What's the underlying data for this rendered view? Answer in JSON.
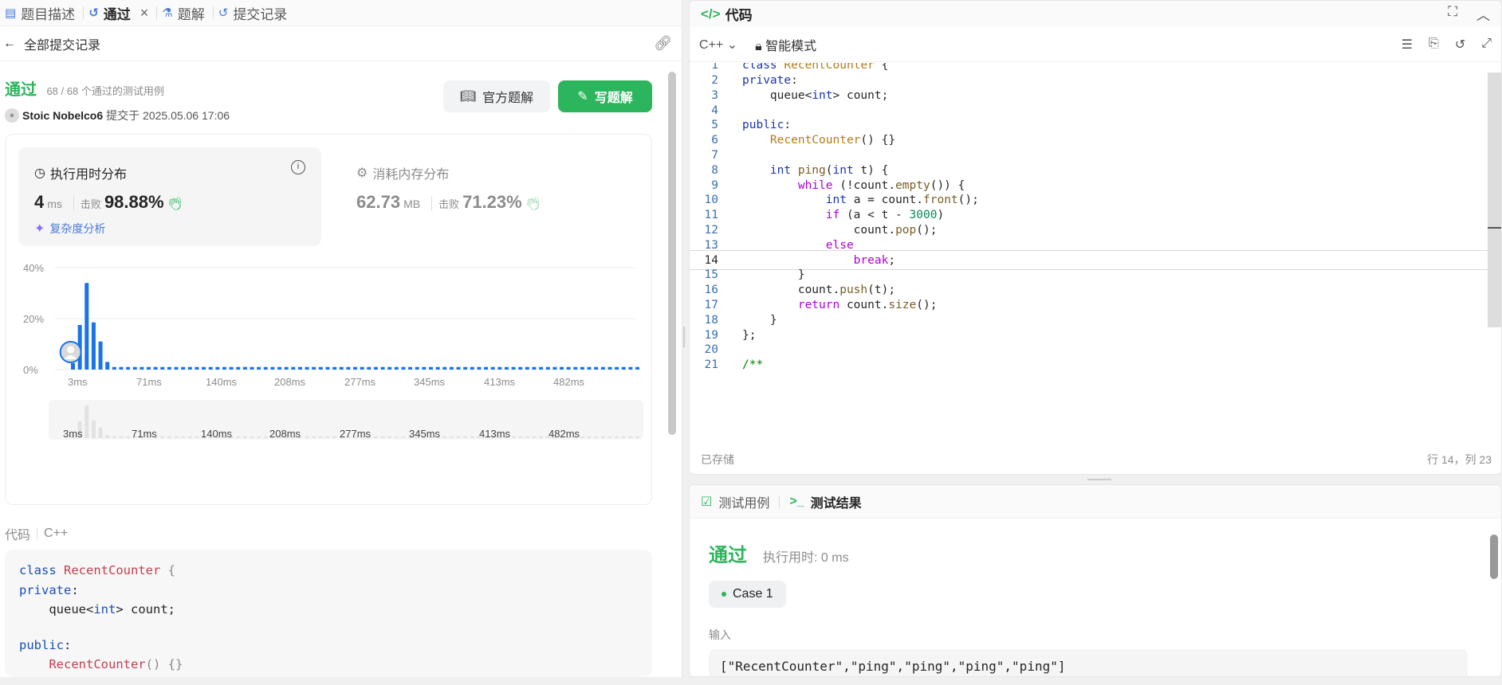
{
  "tabs": [
    {
      "label": "题目描述",
      "icon": "document-icon"
    },
    {
      "label": "通过",
      "icon": "history-icon",
      "active": true
    },
    {
      "label": "题解",
      "icon": "flask-icon"
    },
    {
      "label": "提交记录",
      "icon": "history-icon"
    }
  ],
  "back": {
    "label": "全部提交记录"
  },
  "result": {
    "status": "通过",
    "summary": "68 / 68 个通过的测试用例",
    "user": "Stoic Nobelco6",
    "submitted_at": "提交于 2025.05.06 17:06"
  },
  "buttons": {
    "official": "官方题解",
    "write": "写题解"
  },
  "runtime": {
    "title": "执行用时分布",
    "value": "4",
    "unit": "ms",
    "beat_label": "击败",
    "beat": "98.88%",
    "complexity": "复杂度分析"
  },
  "memory": {
    "title": "消耗内存分布",
    "value": "62.73",
    "unit": "MB",
    "beat_label": "击败",
    "beat": "71.23%"
  },
  "chart_data": {
    "type": "bar",
    "title": "",
    "xlabel": "",
    "ylabel": "",
    "y_ticks": [
      "40%",
      "20%",
      "0%"
    ],
    "ylim": [
      0,
      40
    ],
    "x_ticks": [
      "3ms",
      "71ms",
      "140ms",
      "208ms",
      "277ms",
      "345ms",
      "413ms",
      "482ms"
    ],
    "values": [
      2.5,
      17.5,
      34,
      18.5,
      11,
      3,
      1,
      1,
      1,
      1,
      1,
      1,
      1,
      1,
      1,
      1,
      1,
      1,
      1,
      1,
      1,
      1,
      1,
      1,
      1,
      1,
      1,
      1,
      1,
      1,
      1,
      1,
      1,
      1,
      1,
      1,
      1,
      1,
      1,
      1,
      1,
      1,
      1,
      1,
      1,
      1,
      1,
      1,
      1,
      1,
      1,
      1,
      1,
      1,
      1,
      1,
      1,
      1,
      1,
      1,
      1,
      1,
      1,
      1,
      1,
      1,
      1,
      1,
      1,
      1,
      1,
      1,
      1,
      1,
      1,
      1,
      1,
      1,
      1,
      1,
      1,
      1,
      1
    ],
    "highlight_index": 1,
    "color": "#1a73e8",
    "grid": true
  },
  "code_section": {
    "label": "代码",
    "lang": "C++"
  },
  "code_preview": [
    [
      [
        "kw",
        "class "
      ],
      [
        "cls",
        "RecentCounter"
      ],
      [
        "gr",
        " {"
      ]
    ],
    [
      [
        "kw",
        "private"
      ],
      [
        "pl",
        ":"
      ]
    ],
    [
      [
        "pl",
        "    queue<"
      ],
      [
        "kw",
        "int"
      ],
      [
        "pl",
        "> count;"
      ]
    ],
    [
      [
        "pl",
        ""
      ]
    ],
    [
      [
        "kw",
        "public"
      ],
      [
        "pl",
        ":"
      ]
    ],
    [
      [
        "cls",
        "    RecentCounter"
      ],
      [
        "gr",
        "() {}"
      ]
    ]
  ],
  "editor": {
    "title": "代码",
    "lang": "C++",
    "mode": "智能模式",
    "saved": "已存储",
    "cursor": "行 14，列 23",
    "current_line": 14,
    "lines": [
      [
        [
          "kw",
          "class "
        ],
        [
          "cls",
          "RecentCounter "
        ],
        [
          "pl",
          "{"
        ]
      ],
      [
        [
          "kw",
          "private"
        ],
        [
          "pl",
          ":"
        ]
      ],
      [
        [
          "pl",
          "    queue<"
        ],
        [
          "kw",
          "int"
        ],
        [
          "pl",
          "> count;"
        ]
      ],
      [
        [
          "pl",
          ""
        ]
      ],
      [
        [
          "kw",
          "public"
        ],
        [
          "pl",
          ":"
        ]
      ],
      [
        [
          "cls",
          "    RecentCounter"
        ],
        [
          "pl",
          "() {}"
        ]
      ],
      [
        [
          "pl",
          ""
        ]
      ],
      [
        [
          "kw",
          "    int "
        ],
        [
          "fn",
          "ping"
        ],
        [
          "pl",
          "("
        ],
        [
          "kw",
          "int "
        ],
        [
          "pl",
          "t) {"
        ]
      ],
      [
        [
          "ctl",
          "        while "
        ],
        [
          "pl",
          "(!count."
        ],
        [
          "fn",
          "empty"
        ],
        [
          "pl",
          "()) {"
        ]
      ],
      [
        [
          "kw",
          "            int "
        ],
        [
          "pl",
          "a = count."
        ],
        [
          "fn",
          "front"
        ],
        [
          "pl",
          "();"
        ]
      ],
      [
        [
          "ctl",
          "            if "
        ],
        [
          "pl",
          "(a < t - "
        ],
        [
          "num",
          "3000"
        ],
        [
          "pl",
          ")"
        ]
      ],
      [
        [
          "pl",
          "                count."
        ],
        [
          "fn",
          "pop"
        ],
        [
          "pl",
          "();"
        ]
      ],
      [
        [
          "ctl",
          "            else"
        ]
      ],
      [
        [
          "ctl",
          "                break"
        ],
        [
          "pl",
          ";"
        ]
      ],
      [
        [
          "pl",
          "        }"
        ]
      ],
      [
        [
          "pl",
          "        count."
        ],
        [
          "fn",
          "push"
        ],
        [
          "pl",
          "(t);"
        ]
      ],
      [
        [
          "ctl",
          "        return "
        ],
        [
          "pl",
          "count."
        ],
        [
          "fn",
          "size"
        ],
        [
          "pl",
          "();"
        ]
      ],
      [
        [
          "pl",
          "    }"
        ]
      ],
      [
        [
          "pl",
          "};"
        ]
      ],
      [
        [
          "pl",
          ""
        ]
      ],
      [
        [
          "cm",
          "/**"
        ]
      ]
    ]
  },
  "results": {
    "tab_cases": "测试用例",
    "tab_result": "测试结果",
    "status": "通过",
    "exec_time": "执行用时: 0 ms",
    "case": "Case 1",
    "input_label": "输入",
    "input_value": "[\"RecentCounter\",\"ping\",\"ping\",\"ping\",\"ping\"]"
  },
  "colors": {
    "accent": "#2db55d",
    "bar": "#1a73e8",
    "link": "#4a7ad6"
  }
}
